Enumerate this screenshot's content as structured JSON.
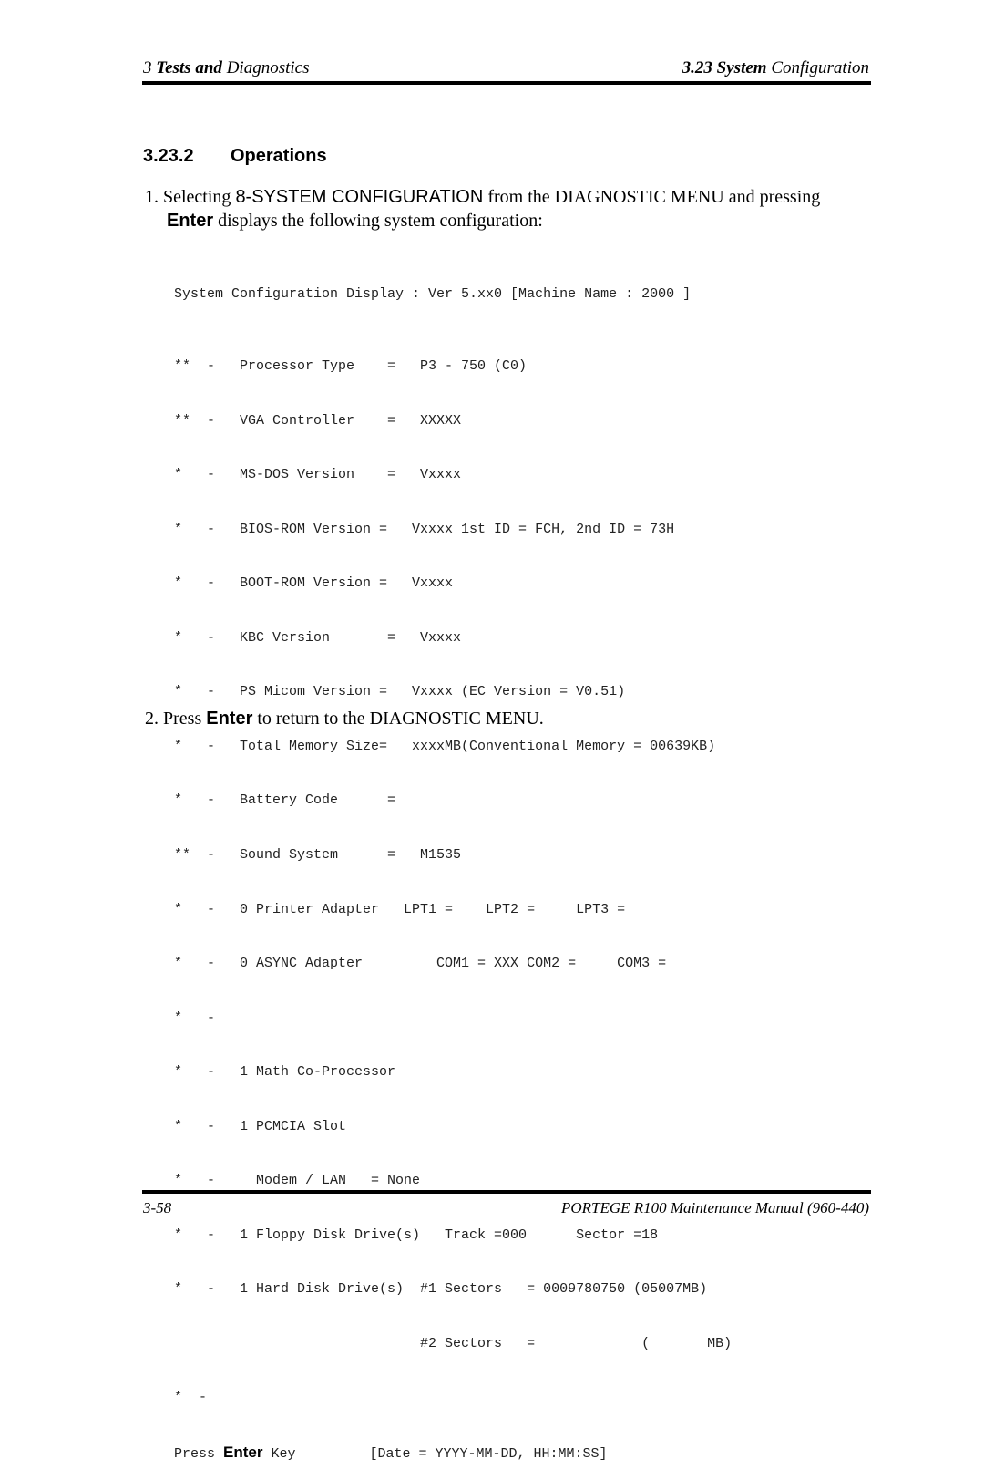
{
  "header": {
    "left_num": "3 ",
    "left_bold": "Tests and",
    "left_rest": " Diagnostics",
    "right_bold": "3.23  System",
    "right_rest": " Configuration"
  },
  "section": {
    "number": "3.23.2",
    "title": "Operations"
  },
  "step1": {
    "prefix": "1. Selecting ",
    "menu_item": "8-SYSTEM CONFIGURATION",
    "mid": " from the DIAGNOSTIC MENU and pressing",
    "key": "Enter",
    "rest": " displays the following system configuration:"
  },
  "screen": {
    "title": "System Configuration Display : Ver 5.xx0 [Machine Name : 2000 ]",
    "lines": [
      "**  -   Processor Type    =   P3 - 750 (C0)",
      "**  -   VGA Controller    =   XXXXX",
      "*   -   MS-DOS Version    =   Vxxxx",
      "*   -   BIOS-ROM Version =   Vxxxx 1st ID = FCH, 2nd ID = 73H",
      "*   -   BOOT-ROM Version =   Vxxxx",
      "*   -   KBC Version       =   Vxxxx",
      "*   -   PS Micom Version =   Vxxxx (EC Version = V0.51)",
      "*   -   Total Memory Size=   xxxxMB(Conventional Memory = 00639KB)",
      "*   -   Battery Code      =",
      "**  -   Sound System      =   M1535",
      "*   -   0 Printer Adapter   LPT1 =    LPT2 =     LPT3 =",
      "*   -   0 ASYNC Adapter         COM1 = XXX COM2 =     COM3 =",
      "*   -",
      "*   -   1 Math Co-Processor",
      "*   -   1 PCMCIA Slot",
      "*   -     Modem / LAN   = None",
      "*   -   1 Floppy Disk Drive(s)   Track =000      Sector =18",
      "*   -   1 Hard Disk Drive(s)  #1 Sectors   = 0009780750 (05007MB)",
      "                              #2 Sectors   =             (       MB)"
    ],
    "last_marker": "*  -",
    "press_prefix": "Press ",
    "press_key": "Enter",
    "press_suffix": " Key         [Date = YYYY-MM-DD, HH:MM:SS]"
  },
  "step2": {
    "prefix": "2. Press ",
    "key": "Enter",
    "rest": " to return to the DIAGNOSTIC MENU."
  },
  "footer": {
    "page": "3-58",
    "manual": "PORTEGE R100 Maintenance Manual (960-440)"
  }
}
